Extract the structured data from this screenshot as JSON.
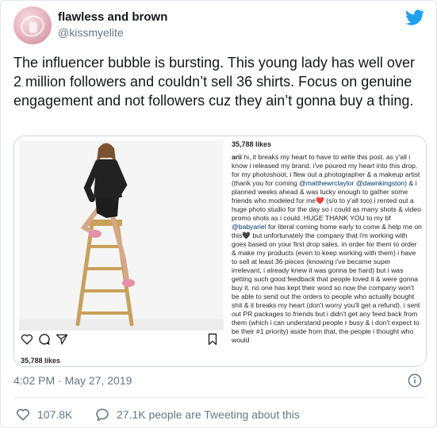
{
  "author": {
    "display_name": "flawless and brown",
    "handle": "@kissmyelite"
  },
  "tweet": {
    "text": "The influencer bubble is bursting. This young lady has well over 2 million followers and couldn’t sell 36 shirts. Focus on genuine engagement and not followers cuz they ain’t gonna buy a thing.",
    "timestamp": "4:02 PM · May 27, 2019"
  },
  "embedded_post": {
    "likes_top": "35,788 likes",
    "likes_bottom": "35,788 likes",
    "caption_user": "arii",
    "caption_parts": [
      " hi, it breaks my heart to have to write this post. as y'all i know i released my brand. i've poured my heart into this drop. for my photoshoot, i flew out a photographer & a makeup artist (thank you for coming ",
      "@matthewrctaylor",
      " ",
      "@dawnkingston",
      ") & i planned weeks ahead & was lucky enough to gather some friends who modeled for me",
      "❤️",
      " (s/o to y'all too) i rented out a huge photo studio for the day so i could as many shots & video promo shots as i could. HUGE THANK YOU to my bf ",
      "@babyariel",
      " for literal coming home early to come & help me on this",
      "🖤",
      " but unfortunately the company that i'm working with goes based on your first drop sales. in order for them to order & make my products (even to keep working with them) i have to sell at least 36 pieces (knowing i've became super irrelevant, i already knew it was gonna be hard) but i was getting such good feedback that people loved it & were gonna buy it. no one has kept their word so now the company won't be able to send out the orders to people who actually bought shit & it breaks my heart (don't worry you'll get a refund). i sent out PR packages to friends but i didn't get any feed back from them (which i can understand people r busy & i don't expect to be their #1 priority) aside from that, the people i thought who would"
    ]
  },
  "stats": {
    "likes": "107.8K",
    "people_tweeting": "27.1K people are Tweeting about this"
  },
  "colors": {
    "twitter_blue": "#1da1f2",
    "text_secondary": "#657786",
    "border": "#e1e8ed"
  },
  "icons": {
    "brand": "twitter-bird-icon",
    "like": "heart-icon",
    "reply": "speech-bubble-icon",
    "info": "info-icon"
  }
}
